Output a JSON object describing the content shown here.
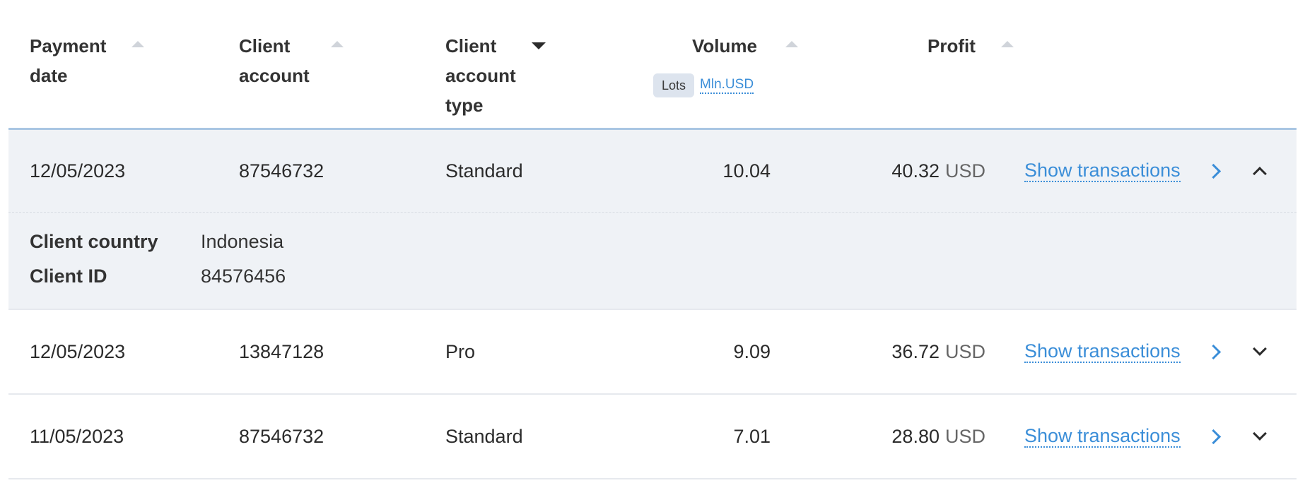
{
  "table": {
    "headers": {
      "payment_date": [
        "Payment",
        "date"
      ],
      "client_account": [
        "Client",
        "account"
      ],
      "client_account_type": [
        "Client",
        "account",
        "type"
      ],
      "volume": "Volume",
      "profit": "Profit"
    },
    "volume_units": {
      "active": "Lots",
      "alternate": "Mln.USD"
    },
    "rows": [
      {
        "date": "12/05/2023",
        "account": "87546732",
        "type": "Standard",
        "volume": "10.04",
        "profit": "40.32",
        "currency": "USD",
        "action": "Show transactions"
      },
      {
        "date": "12/05/2023",
        "account": "13847128",
        "type": "Pro",
        "volume": "9.09",
        "profit": "36.72",
        "currency": "USD",
        "action": "Show transactions"
      },
      {
        "date": "11/05/2023",
        "account": "87546732",
        "type": "Standard",
        "volume": "7.01",
        "profit": "28.80",
        "currency": "USD",
        "action": "Show transactions"
      }
    ],
    "details": {
      "country_label": "Client country",
      "country_value": "Indonesia",
      "id_label": "Client ID",
      "id_value": "84576456"
    }
  },
  "colors": {
    "link": "#3b8ed8",
    "expanded_bg": "#eff2f6",
    "header_border": "#a9c6e3"
  }
}
